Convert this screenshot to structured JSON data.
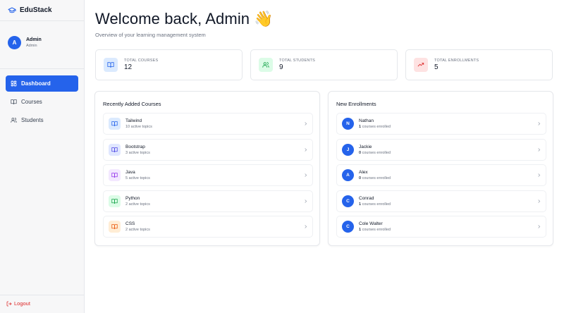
{
  "app": {
    "name": "EduStack"
  },
  "profile": {
    "initial": "A",
    "name": "Admin",
    "role": "Admin"
  },
  "sidebar": {
    "items": [
      {
        "label": "Dashboard",
        "icon": "dashboard-icon",
        "active": true
      },
      {
        "label": "Courses",
        "icon": "book-icon",
        "active": false
      },
      {
        "label": "Students",
        "icon": "users-icon",
        "active": false
      }
    ],
    "logout_label": "Logout"
  },
  "header": {
    "title": "Welcome back, Admin 👋",
    "subtitle": "Overview of your learning management system"
  },
  "stats": [
    {
      "label": "TOTAL COURSES",
      "value": "12",
      "icon": "book-icon",
      "color": "#2563eb",
      "bg": "#dbeafe"
    },
    {
      "label": "TOTAL STUDENTS",
      "value": "9",
      "icon": "users-icon",
      "color": "#16a34a",
      "bg": "#dcfce7"
    },
    {
      "label": "TOTAL ENROLLMENTS",
      "value": "5",
      "icon": "trending-up-icon",
      "color": "#dc2626",
      "bg": "#fee2e2"
    }
  ],
  "recent_courses": {
    "title": "Recently Added Courses",
    "items": [
      {
        "name": "Tailwind",
        "sub": "10 active topics",
        "color": "#2563eb",
        "bg": "#dbeafe"
      },
      {
        "name": "Bootstrap",
        "sub": "3 active topics",
        "color": "#4f46e5",
        "bg": "#e0e7ff"
      },
      {
        "name": "Java",
        "sub": "5 active topics",
        "color": "#9333ea",
        "bg": "#f3e8ff"
      },
      {
        "name": "Python",
        "sub": "2 active topics",
        "color": "#16a34a",
        "bg": "#dcfce7"
      },
      {
        "name": "CSS",
        "sub": "2 active topics",
        "color": "#ea580c",
        "bg": "#ffedd5"
      }
    ]
  },
  "new_enrollments": {
    "title": "New Enrollments",
    "suffix": "courses enrolled",
    "items": [
      {
        "initial": "N",
        "name": "Nathan",
        "count": "1"
      },
      {
        "initial": "J",
        "name": "Jackie",
        "count": "0"
      },
      {
        "initial": "A",
        "name": "Alex",
        "count": "0"
      },
      {
        "initial": "C",
        "name": "Conrad",
        "count": "1"
      },
      {
        "initial": "C",
        "name": "Cole Walter",
        "count": "1"
      }
    ]
  }
}
